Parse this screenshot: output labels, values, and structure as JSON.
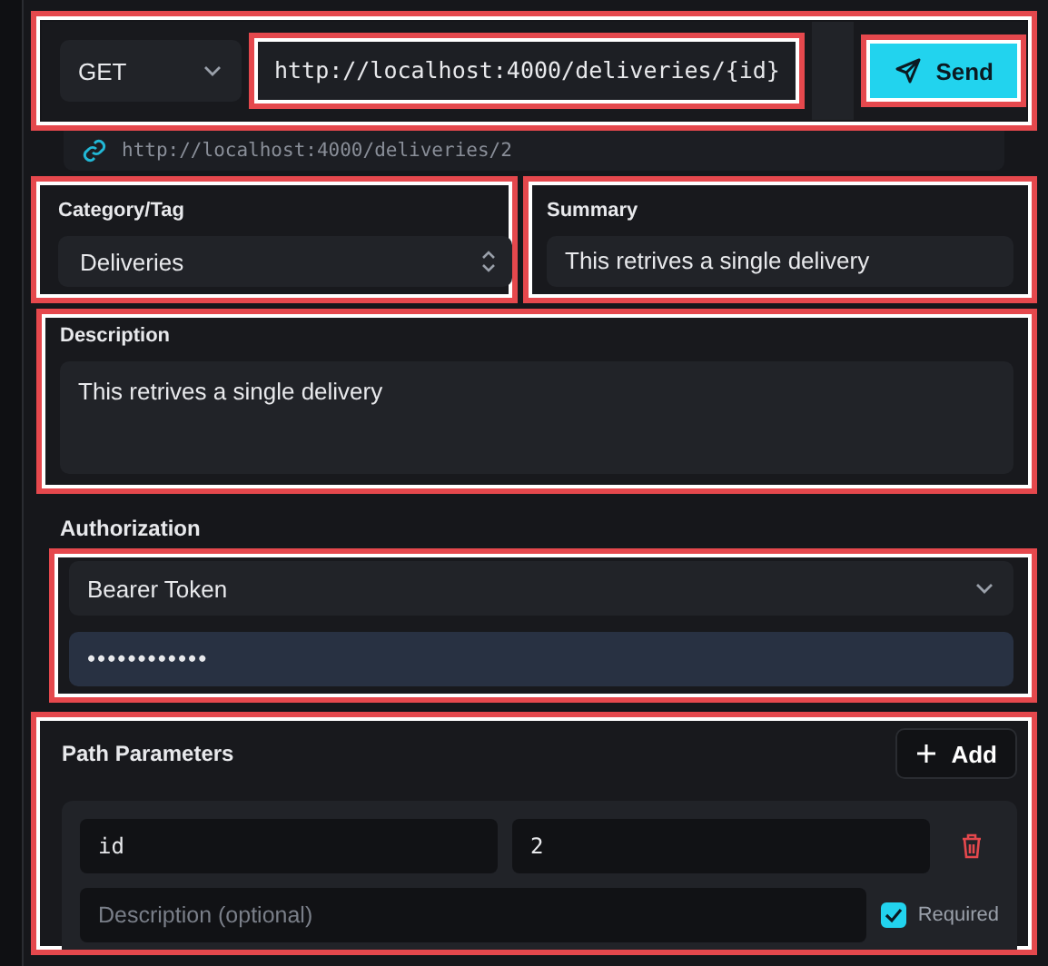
{
  "request": {
    "method": "GET",
    "url": "http://localhost:4000/deliveries/{id}",
    "send_label": "Send",
    "resolved_url": "http://localhost:4000/deliveries/2"
  },
  "category": {
    "label": "Category/Tag",
    "value": "Deliveries"
  },
  "summary": {
    "label": "Summary",
    "value": "This retrives a single delivery"
  },
  "description": {
    "label": "Description",
    "value": "This retrives a single delivery"
  },
  "authorization": {
    "label": "Authorization",
    "type": "Bearer Token",
    "token": "••••••••••••"
  },
  "path_parameters": {
    "title": "Path Parameters",
    "add_label": "Add",
    "items": [
      {
        "name": "id",
        "value": "2",
        "description_placeholder": "Description (optional)",
        "required": true,
        "required_label": "Required"
      }
    ]
  }
}
